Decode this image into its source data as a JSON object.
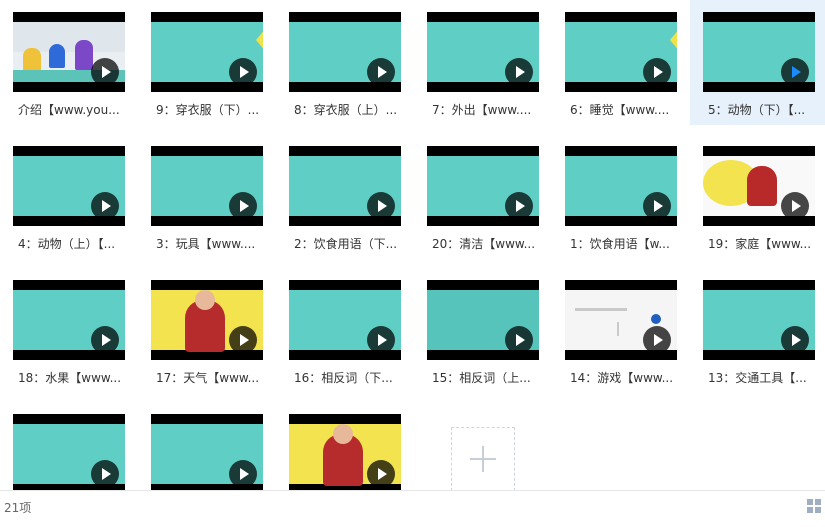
{
  "items": [
    {
      "label": "介绍【www.you...",
      "thumb": "photo",
      "selected": false
    },
    {
      "label": "9：穿衣服（下）...",
      "thumb": "teal-wedge",
      "selected": false
    },
    {
      "label": "8：穿衣服（上）...",
      "thumb": "teal",
      "selected": false
    },
    {
      "label": "7：外出【www....",
      "thumb": "teal",
      "selected": false
    },
    {
      "label": "6：睡觉【www....",
      "thumb": "teal-wedge",
      "selected": false
    },
    {
      "label": "5：动物（下）【...",
      "thumb": "teal",
      "selected": true
    },
    {
      "label": "4：动物（上）【...",
      "thumb": "teal",
      "selected": false
    },
    {
      "label": "3：玩具【www....",
      "thumb": "teal",
      "selected": false
    },
    {
      "label": "2：饮食用语（下...",
      "thumb": "teal",
      "selected": false
    },
    {
      "label": "20：清洁【www...",
      "thumb": "teal",
      "selected": false
    },
    {
      "label": "1：饮食用语【w...",
      "thumb": "teal",
      "selected": false
    },
    {
      "label": "19：家庭【www...",
      "thumb": "poster",
      "selected": false
    },
    {
      "label": "18：水果【www...",
      "thumb": "teal",
      "selected": false
    },
    {
      "label": "17：天气【www...",
      "thumb": "yellow",
      "selected": false
    },
    {
      "label": "16：相反词（下...",
      "thumb": "teal",
      "selected": false
    },
    {
      "label": "15：相反词（上...",
      "thumb": "teal-dark",
      "selected": false
    },
    {
      "label": "14：游戏【www...",
      "thumb": "white",
      "selected": false
    },
    {
      "label": "13：交通工具【...",
      "thumb": "teal",
      "selected": false
    },
    {
      "label": "",
      "thumb": "teal",
      "selected": false
    },
    {
      "label": "",
      "thumb": "teal",
      "selected": false
    },
    {
      "label": "",
      "thumb": "yellow",
      "selected": false
    }
  ],
  "status": {
    "count": "21项"
  },
  "icons": {
    "play": "play-icon",
    "add": "add-icon",
    "view": "grid-view-icon"
  },
  "colors": {
    "teal": "#5fcfc5",
    "yellow": "#f2e34f",
    "selection": "#e7f1fb",
    "accent": "#1a8cff"
  }
}
